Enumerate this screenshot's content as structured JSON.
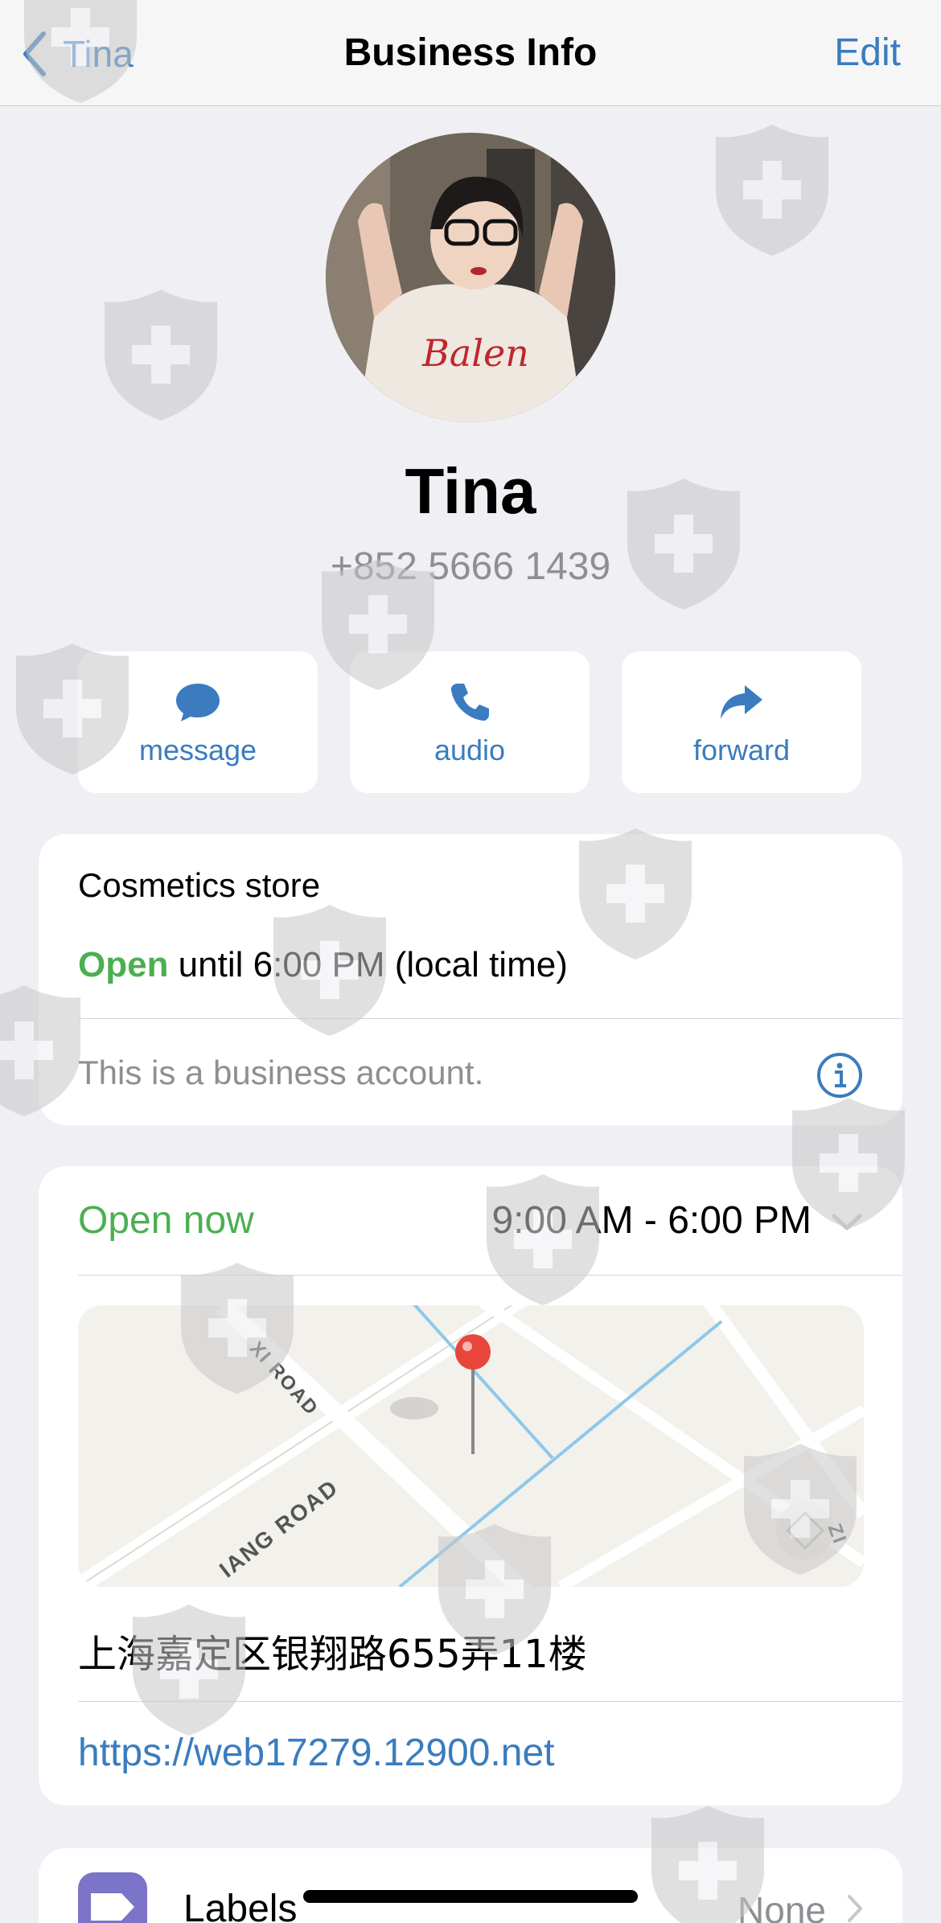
{
  "nav": {
    "back_label": "Tina",
    "title": "Business Info",
    "edit_label": "Edit"
  },
  "profile": {
    "name": "Tina",
    "phone": "+852 5666 1439",
    "avatar_icon": "profile-photo",
    "shirt_text": "Balen"
  },
  "actions": [
    {
      "label": "message",
      "icon": "chat-bubble-icon"
    },
    {
      "label": "audio",
      "icon": "phone-icon"
    },
    {
      "label": "forward",
      "icon": "forward-arrow-icon"
    }
  ],
  "business": {
    "category": "Cosmetics store",
    "status_word": "Open",
    "status_rest": " until 6:00 PM (local time)",
    "note": "This is a business account."
  },
  "hours": {
    "status": "Open now",
    "time_range": "9:00 AM - 6:00 PM"
  },
  "map": {
    "road_labels": [
      "XI ROAD",
      "IANG ROAD",
      "ZI"
    ]
  },
  "location": {
    "address": "上海嘉定区银翔路655弄11楼",
    "url": "https://web17279.12900.net"
  },
  "labels_row": {
    "title": "Labels",
    "value": "None"
  },
  "colors": {
    "accent": "#3a7cbf",
    "open_green": "#4caf50",
    "secondary_text": "#8e8e93",
    "background": "#efeff4",
    "pin_red": "#e8463c",
    "labels_icon": "#7b74c9"
  }
}
